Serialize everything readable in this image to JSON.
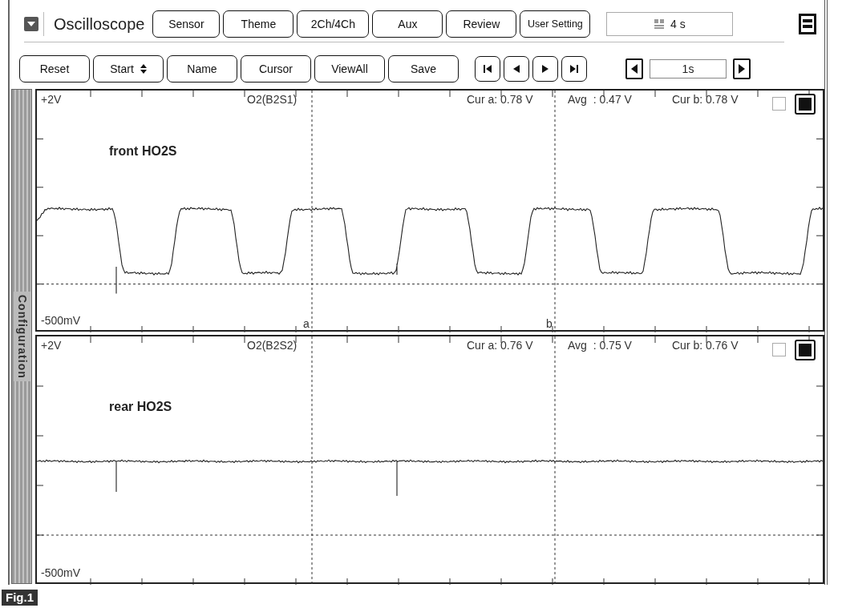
{
  "toolbar": {
    "title": "Oscilloscope",
    "buttons": [
      "Sensor",
      "Theme",
      "2Ch/4Ch",
      "Aux",
      "Review",
      "User Setting"
    ],
    "time_field": {
      "value": "4 s"
    }
  },
  "controls": {
    "buttons": [
      {
        "label": "Reset",
        "kind": "plain"
      },
      {
        "label": "Start",
        "kind": "spinner"
      },
      {
        "label": "Name",
        "kind": "plain"
      },
      {
        "label": "Cursor",
        "kind": "plain"
      },
      {
        "label": "ViewAll",
        "kind": "plain"
      },
      {
        "label": "Save",
        "kind": "plain"
      }
    ],
    "step_field": {
      "value": "1s"
    }
  },
  "side_tab": {
    "label": "Configuration"
  },
  "channels": [
    {
      "kind": "switching",
      "top_label": "+2V",
      "bottom_label": "-500mV",
      "name": "O2(B2S1)",
      "cursor_a": "Cur a: 0.78 V",
      "avg": "Avg  : 0.47 V",
      "cursor_b": "Cur b: 0.78 V",
      "checked": false,
      "selected": true,
      "annotation": "front HO2S",
      "cursor_labels": [
        "a",
        "b"
      ]
    },
    {
      "kind": "flat",
      "top_label": "+2V",
      "bottom_label": "-500mV",
      "name": "O2(B2S2)",
      "cursor_a": "Cur a: 0.76 V",
      "avg": "Avg  : 0.75 V",
      "cursor_b": "Cur b: 0.76 V",
      "checked": false,
      "selected": true,
      "annotation": "rear HO2S"
    }
  ],
  "figure_label": "Fig.1"
}
